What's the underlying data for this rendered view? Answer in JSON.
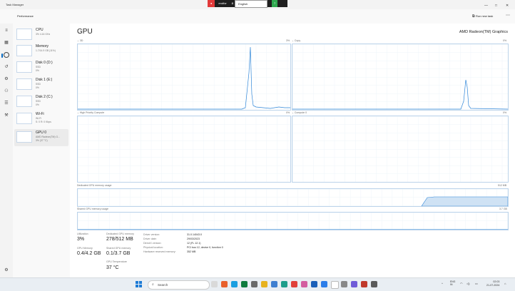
{
  "window": {
    "title": "Task Manager",
    "minimize_glyph": "—",
    "maximize_glyph": "□",
    "close_glyph": "✕"
  },
  "overlay": {
    "recording_label": "endfor",
    "language_label": "English",
    "badge_label": "7"
  },
  "command_bar": {
    "section_title": "Performance",
    "run_new_task": "Run new task",
    "more_glyph": "⋯"
  },
  "nav_icons": [
    "hamburger-icon",
    "processes-icon",
    "performance-icon",
    "app-history-icon",
    "startup-apps-icon",
    "users-icon",
    "details-icon",
    "services-icon",
    "settings-icon"
  ],
  "sidebar": {
    "items": [
      {
        "name": "CPU",
        "sub1": "3% 4.16 GHz",
        "sub2": ""
      },
      {
        "name": "Memory",
        "sub1": "1.7/14.9 GB (11%)",
        "sub2": ""
      },
      {
        "name": "Disk 0 (D:)",
        "sub1": "SSD",
        "sub2": "0%"
      },
      {
        "name": "Disk 1 (E:)",
        "sub1": "SSD",
        "sub2": "0%"
      },
      {
        "name": "Disk 2 (C:)",
        "sub1": "SSD",
        "sub2": "0%"
      },
      {
        "name": "Wi-Fi",
        "sub1": "Wi-Fi",
        "sub2": "S: 0 R: 0 Kbps"
      },
      {
        "name": "GPU 0",
        "sub1": "AMD Radeon(TM) G...",
        "sub2": "3% (37 °C)"
      }
    ]
  },
  "main": {
    "title": "GPU",
    "gpu_name": "AMD Radeon(TM) Graphics",
    "graphs": {
      "g1": {
        "left": "3D",
        "right": "3%"
      },
      "g2": {
        "left": "Copy",
        "right": "0%"
      },
      "g3": {
        "left": "High Priority Compute",
        "right": "0%"
      },
      "g4": {
        "left": "Compute 0",
        "right": "0%"
      },
      "dedicated": {
        "left": "Dedicated GPU memory usage",
        "right": "512 MB"
      },
      "shared": {
        "left": "Shared GPU memory usage",
        "right": "3.7 GB"
      }
    }
  },
  "stats": {
    "utilization": {
      "label": "Utilization",
      "value": "3%"
    },
    "dedicated": {
      "label": "Dedicated GPU memory",
      "value": "278/512 MB"
    },
    "gpu_memory": {
      "label": "GPU Memory",
      "value": "0.4/4.2 GB"
    },
    "shared": {
      "label": "Shared GPU memory",
      "value": "0.1/3.7 GB"
    },
    "temperature": {
      "label": "GPU Temperature",
      "value": "37 °C"
    }
  },
  "properties": [
    {
      "label": "Driver version:",
      "value": "31.0.14043.0"
    },
    {
      "label": "Driver date:",
      "value": "29/03/2023"
    },
    {
      "label": "DirectX version:",
      "value": "12 (FL 12.1)"
    },
    {
      "label": "Physical location:",
      "value": "PCI bus 12, device 0, function 0"
    },
    {
      "label": "Hardware reserved memory:",
      "value": "352 MB"
    }
  ],
  "taskbar": {
    "search_placeholder": "Search",
    "tray_chevron": "^",
    "tray_lang": "ENG\nIN",
    "clock_time": "02:03",
    "clock_date": "21-07-2024"
  }
}
